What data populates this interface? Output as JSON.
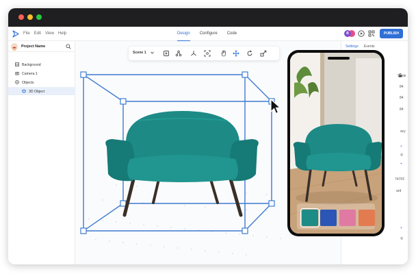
{
  "menu": [
    "File",
    "Edit",
    "View",
    "Help"
  ],
  "tabs": [
    "Design",
    "Configure",
    "Code"
  ],
  "avatar": "B",
  "publish": "PUBLISH",
  "project": "Project Name",
  "tree": [
    "Background",
    "Camera 1",
    "Objects",
    "3D Object"
  ],
  "scene": "Scene 1",
  "right_tabs": [
    "Settings",
    "Events"
  ],
  "right_fields": {
    "scale": "Scale",
    "v1": "84",
    "v2": "84",
    "v3": "84",
    "opacity": "acy",
    "hex": "747FF",
    "fill": "ard"
  },
  "swatches": [
    "#1e8c86",
    "#2b56b5",
    "#e07aa3",
    "#e37b51"
  ],
  "accent": "#2f6fd6"
}
